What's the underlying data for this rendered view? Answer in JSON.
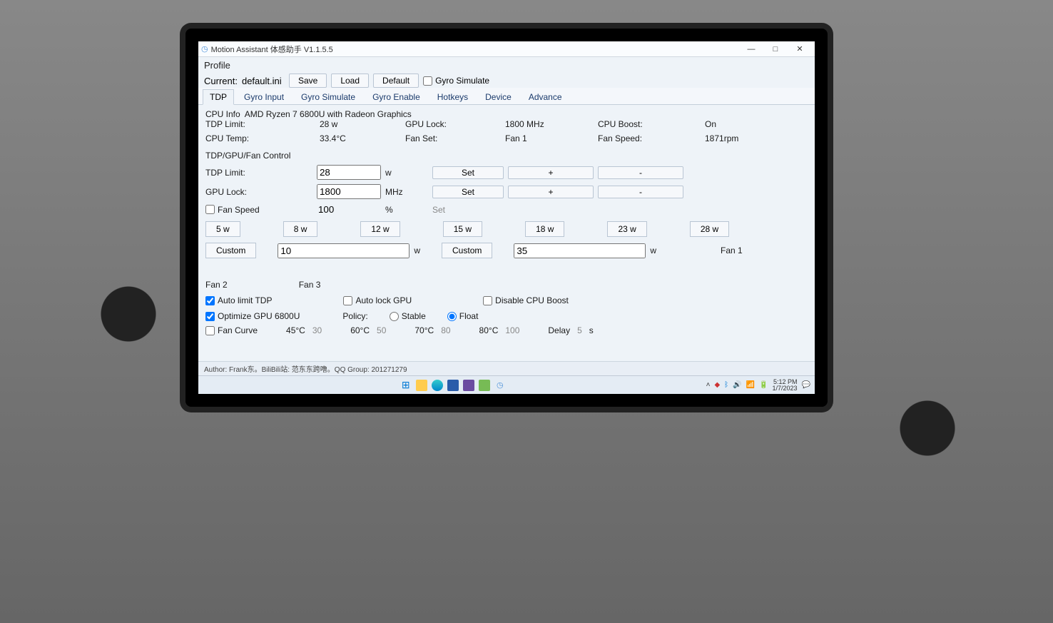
{
  "window": {
    "title": "Motion Assistant 体感助手 V1.1.5.5",
    "minimize": "—",
    "maximize": "□",
    "close": "✕"
  },
  "profile": {
    "heading": "Profile",
    "current_label": "Current:",
    "current_value": "default.ini",
    "save": "Save",
    "load": "Load",
    "default": "Default",
    "gyro_simulate": "Gyro Simulate"
  },
  "tabs": {
    "tdp": "TDP",
    "gyro_input": "Gyro Input",
    "gyro_simulate": "Gyro Simulate",
    "gyro_enable": "Gyro Enable",
    "hotkeys": "Hotkeys",
    "device": "Device",
    "advance": "Advance"
  },
  "info": {
    "cpu_info_label": "CPU Info",
    "cpu_info_value": "AMD Ryzen 7 6800U with Radeon Graphics",
    "tdp_limit_label": "TDP Limit:",
    "tdp_limit_value": "28 w",
    "gpu_lock_label": "GPU Lock:",
    "gpu_lock_value": "1800 MHz",
    "cpu_boost_label": "CPU Boost:",
    "cpu_boost_value": "On",
    "cpu_temp_label": "CPU Temp:",
    "cpu_temp_value": "33.4°C",
    "fan_set_label": "Fan Set:",
    "fan_set_value": "Fan 1",
    "fan_speed_label": "Fan Speed:",
    "fan_speed_value": "1871rpm"
  },
  "control": {
    "section": "TDP/GPU/Fan Control",
    "tdp_limit_label": "TDP Limit:",
    "tdp_limit_value": "28",
    "tdp_limit_unit": "w",
    "gpu_lock_label": "GPU Lock:",
    "gpu_lock_value": "1800",
    "gpu_lock_unit": "MHz",
    "fan_speed_label": "Fan Speed",
    "fan_speed_value": "100",
    "fan_speed_unit": "%",
    "set": "Set",
    "plus": "+",
    "minus": "-"
  },
  "presets": {
    "p5": "5 w",
    "p8": "8 w",
    "p12": "12 w",
    "p15": "15 w",
    "p18": "18 w",
    "p23": "23 w",
    "p28": "28 w",
    "custom": "Custom",
    "custom_val": "10",
    "custom_unit": "w",
    "custom2": "Custom",
    "custom2_val": "35",
    "custom2_unit": "w",
    "fan1": "Fan 1",
    "fan2": "Fan 2",
    "fan3": "Fan 3"
  },
  "options": {
    "auto_limit_tdp": "Auto limit TDP",
    "auto_lock_gpu": "Auto lock GPU",
    "disable_cpu_boost": "Disable CPU Boost",
    "optimize_gpu": "Optimize GPU 6800U",
    "policy": "Policy:",
    "stable": "Stable",
    "float": "Float",
    "fan_curve": "Fan Curve",
    "t45_label": "45°C",
    "t45_val": "30",
    "t60_label": "60°C",
    "t60_val": "50",
    "t70_label": "70°C",
    "t70_val": "80",
    "t80_label": "80°C",
    "t80_val": "100",
    "delay_label": "Delay",
    "delay_val": "5",
    "delay_unit": "s"
  },
  "author": "Author: Frank东。BiliBili站: 范东东跨噜。QQ Group: 201271279",
  "taskbar": {
    "time": "5:12 PM",
    "date": "1/7/2023"
  }
}
